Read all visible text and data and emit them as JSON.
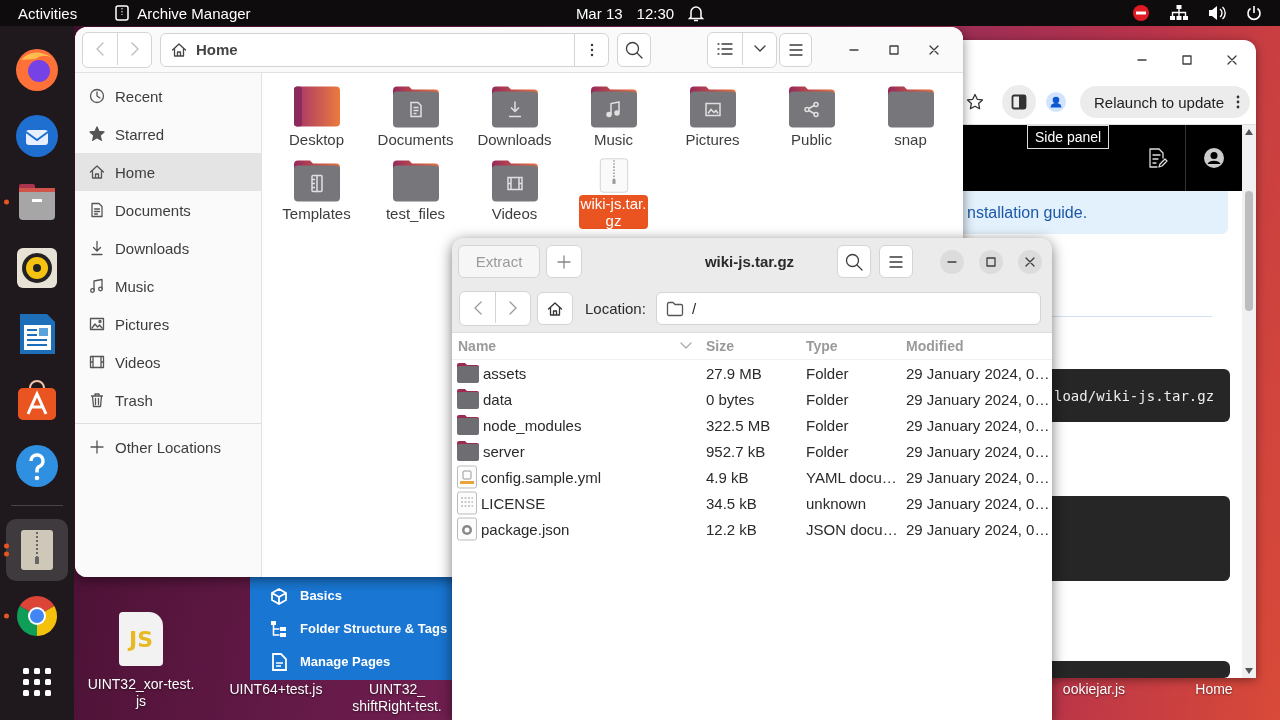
{
  "top_bar": {
    "activities": "Activities",
    "app_name": "Archive Manager",
    "date": "Mar 13",
    "time": "12:30"
  },
  "dock": {
    "apps": [
      {
        "kind": "firefox",
        "running": false,
        "selected": false
      },
      {
        "kind": "thunderbird",
        "running": false,
        "selected": false
      },
      {
        "kind": "files",
        "running": true,
        "multiple_windows": false,
        "selected": false
      },
      {
        "kind": "rhythmbox",
        "running": false,
        "selected": false
      },
      {
        "kind": "writer",
        "running": false,
        "selected": false
      },
      {
        "kind": "app-center",
        "running": false,
        "selected": false
      },
      {
        "kind": "help",
        "running": false,
        "selected": false
      },
      {
        "kind": "separator"
      },
      {
        "kind": "archive-manager",
        "running": true,
        "multiple_windows": true,
        "selected": true
      },
      {
        "kind": "chrome",
        "running": true,
        "multiple_windows": false,
        "selected": false
      },
      {
        "kind": "app-grid",
        "running": false,
        "selected": false
      }
    ]
  },
  "desktop": {
    "icons": [
      {
        "kind": "js",
        "icon_text": "JS",
        "lines": [
          "UINT32_xor-test.",
          "js"
        ]
      },
      {
        "kind": "label-only",
        "lines": [
          "UINT64+test.js"
        ]
      },
      {
        "kind": "label-only",
        "lines": [
          "UINT32_",
          "shiftRight-test."
        ]
      },
      {
        "kind": "label-only",
        "lines": [
          "ookiejar.js"
        ]
      },
      {
        "kind": "label-only",
        "lines": [
          "Home"
        ]
      }
    ]
  },
  "wiki_menu": {
    "items": [
      {
        "kind": "basics",
        "label": "Basics"
      },
      {
        "kind": "tree",
        "label": "Folder Structure & Tags"
      },
      {
        "kind": "page",
        "label": "Manage Pages"
      }
    ]
  },
  "browser_window": {
    "relaunch_label": "Relaunch to update",
    "tooltip": "Side panel",
    "notice": "nstallation guide.",
    "code": "load/wiki-js.tar.gz"
  },
  "files_window": {
    "path": "Home",
    "sidebar": [
      {
        "kind": "recent",
        "label": "Recent",
        "selected": false
      },
      {
        "kind": "starred",
        "label": "Starred",
        "selected": false
      },
      {
        "kind": "home",
        "label": "Home",
        "selected": true
      },
      {
        "kind": "documents",
        "label": "Documents",
        "selected": false
      },
      {
        "kind": "downloads",
        "label": "Downloads",
        "selected": false
      },
      {
        "kind": "music",
        "label": "Music",
        "selected": false
      },
      {
        "kind": "pictures",
        "label": "Pictures",
        "selected": false
      },
      {
        "kind": "videos",
        "label": "Videos",
        "selected": false
      },
      {
        "kind": "trash",
        "label": "Trash",
        "selected": false
      }
    ],
    "other_locations": "Other Locations",
    "items": [
      {
        "kind": "desktop",
        "lines": [
          "Desktop"
        ],
        "selected": false
      },
      {
        "kind": "documents",
        "lines": [
          "Documents"
        ],
        "selected": false
      },
      {
        "kind": "downloads",
        "lines": [
          "Downloads"
        ],
        "selected": false
      },
      {
        "kind": "music",
        "lines": [
          "Music"
        ],
        "selected": false
      },
      {
        "kind": "pictures",
        "lines": [
          "Pictures"
        ],
        "selected": false
      },
      {
        "kind": "public",
        "lines": [
          "Public"
        ],
        "selected": false
      },
      {
        "kind": "plain",
        "lines": [
          "snap"
        ],
        "selected": false
      },
      {
        "kind": "templates",
        "lines": [
          "Templates"
        ],
        "selected": false
      },
      {
        "kind": "plain",
        "lines": [
          "test_files"
        ],
        "selected": false
      },
      {
        "kind": "videos",
        "lines": [
          "Videos"
        ],
        "selected": false
      },
      {
        "kind": "archive",
        "lines": [
          "wiki-js.tar.",
          "gz"
        ],
        "selected": true
      }
    ]
  },
  "archive_window": {
    "extract": {
      "label": "Extract",
      "disabled": true
    },
    "title": "wiki-js.tar.gz",
    "location_label": "Location:",
    "location": "/",
    "columns": [
      {
        "label": "Name",
        "sorted": true
      },
      {
        "label": "Size",
        "sorted": false
      },
      {
        "label": "Type",
        "sorted": false
      },
      {
        "label": "Modified",
        "sorted": false
      }
    ],
    "rows": [
      {
        "kind": "folder",
        "name": "assets",
        "size": "27.9 MB",
        "type": "Folder",
        "modified": "29 January 2024, 0…"
      },
      {
        "kind": "folder",
        "name": "data",
        "size": "0 bytes",
        "type": "Folder",
        "modified": "29 January 2024, 0…"
      },
      {
        "kind": "folder",
        "name": "node_modules",
        "size": "322.5 MB",
        "type": "Folder",
        "modified": "29 January 2024, 0…"
      },
      {
        "kind": "folder",
        "name": "server",
        "size": "952.7 kB",
        "type": "Folder",
        "modified": "29 January 2024, 0…"
      },
      {
        "kind": "yaml",
        "name": "config.sample.yml",
        "size": "4.9 kB",
        "type": "YAML docu…",
        "modified": "29 January 2024, 0…"
      },
      {
        "kind": "binary",
        "name": "LICENSE",
        "size": "34.5 kB",
        "type": "unknown",
        "modified": "29 January 2024, 0…"
      },
      {
        "kind": "json",
        "name": "package.json",
        "size": "12.2 kB",
        "type": "JSON docu…",
        "modified": "29 January 2024, 0…"
      }
    ]
  }
}
